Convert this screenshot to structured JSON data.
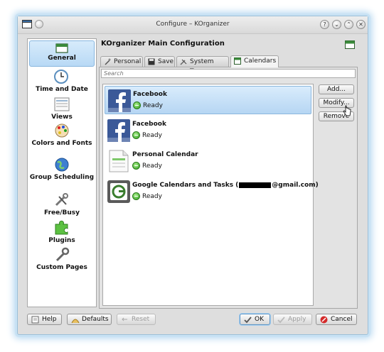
{
  "window": {
    "title": "Configure – KOrganizer"
  },
  "titlebar": {
    "help_glyph": "?",
    "minimize_glyph": "⌄",
    "maximize_glyph": "⌃",
    "close_glyph": "✕"
  },
  "sidebar": {
    "items": [
      {
        "label": "General",
        "icon": "calendar-icon",
        "selected": true
      },
      {
        "label": "Time and Date",
        "icon": "clock-icon"
      },
      {
        "label": "Views",
        "icon": "views-icon"
      },
      {
        "label": "Colors and Fonts",
        "icon": "palette-icon"
      },
      {
        "label": "Group Scheduling",
        "icon": "globe-icon"
      },
      {
        "label": "Free/Busy",
        "icon": "tools-icon"
      },
      {
        "label": "Plugins",
        "icon": "puzzle-icon"
      },
      {
        "label": "Custom Pages",
        "icon": "wrench-icon"
      }
    ]
  },
  "header": {
    "title": "KOrganizer Main Configuration"
  },
  "tabs": [
    {
      "label": "Personal"
    },
    {
      "label": "Save"
    },
    {
      "label": "System Tray"
    },
    {
      "label": "Calendars",
      "active": true
    }
  ],
  "search": {
    "placeholder": "Search"
  },
  "calendars": [
    {
      "name": "Facebook",
      "status": "Ready",
      "icon": "facebook-icon"
    },
    {
      "name": "Facebook",
      "status": "Ready",
      "icon": "facebook-icon"
    },
    {
      "name": "Personal Calendar",
      "status": "Ready",
      "icon": "document-calendar-icon"
    },
    {
      "name_prefix": "Google Calendars and Tasks (",
      "name_suffix": "@gmail.com)",
      "status": "Ready",
      "icon": "google-calendar-icon"
    }
  ],
  "side_buttons": {
    "add": "Add...",
    "modify": "Modify...",
    "remove": "Remove"
  },
  "bottom_buttons": {
    "help": "Help",
    "defaults": "Defaults",
    "reset": "Reset",
    "ok": "OK",
    "apply": "Apply",
    "cancel": "Cancel"
  },
  "colors": {
    "selection": "#b8d9f5",
    "facebook_blue": "#3b5998",
    "window_bg": "#dedede"
  }
}
